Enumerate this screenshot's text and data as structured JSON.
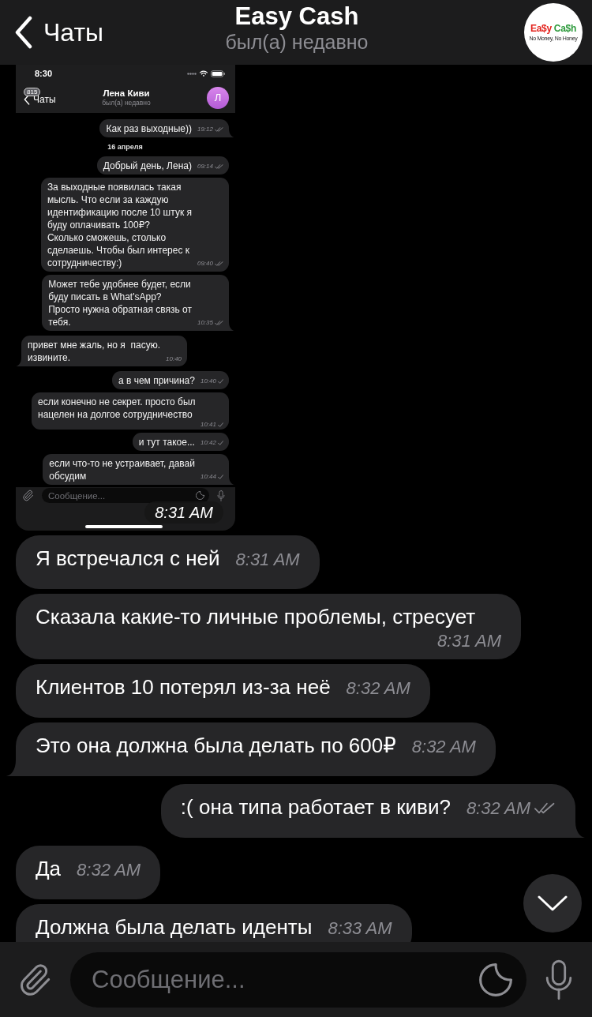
{
  "header": {
    "back_label": "Чаты",
    "title": "Easy Cash",
    "status": "был(а) недавно",
    "logo": {
      "words": [
        {
          "text": "Ea$y",
          "color": "#e3231d"
        },
        {
          "text": "Ca$h",
          "color": "#2d9a3b"
        }
      ],
      "slogan": "No Money, No Honey"
    }
  },
  "messages": [
    {
      "kind": "screenshot",
      "outgoing": false,
      "time": "8:31 AM",
      "screenshot": {
        "status_bar": {
          "time": "8:30"
        },
        "header": {
          "back_label": "Чаты",
          "unread_badge": "815",
          "title": "Лена Киви",
          "status": "был(а) недавно",
          "avatar_letter": "Л"
        },
        "messages": [
          {
            "kind": "text",
            "outgoing": true,
            "text": "Как раз выходные))",
            "time": "19:12",
            "read": true
          },
          {
            "kind": "date",
            "text": "16 апреля"
          },
          {
            "kind": "text",
            "outgoing": true,
            "text": "Добрый день, Лена)",
            "time": "09:14",
            "read": true
          },
          {
            "kind": "text",
            "outgoing": true,
            "text": "За выходные появилась такая\nмысль. Что если за каждую\nидентификацию после 10 штук я\nбуду оплачивать 100₽?\nСколько сможешь, столько\nсделаешь. Чтобы был интерес к\nсотрудничеству:)",
            "time": "09:40",
            "read": true
          },
          {
            "kind": "text",
            "outgoing": true,
            "text": "Может тебе удобнее будет, если\nбуду писать в What'sApp?\nПросто нужна обратная связь от\nтебя.",
            "time": "10:35",
            "read": true
          },
          {
            "kind": "text",
            "outgoing": false,
            "text": "привет мне жаль, но я  пасую.\nизвините.",
            "time": "10:40"
          },
          {
            "kind": "text",
            "outgoing": true,
            "text": "а в чем причина?",
            "time": "10:40",
            "read": false
          },
          {
            "kind": "text",
            "outgoing": true,
            "text": "если конечно не секрет. просто был\nнацелен на долгое сотрудничество",
            "time": "10:41",
            "read": false
          },
          {
            "kind": "text",
            "outgoing": true,
            "text": "и тут такое...",
            "time": "10:42",
            "read": false
          },
          {
            "kind": "text",
            "outgoing": true,
            "text": "если что-то не устраивает, давай\nобсудим",
            "time": "10:44",
            "read": false
          }
        ],
        "composer": {
          "placeholder": "Сообщение..."
        }
      }
    },
    {
      "kind": "text",
      "outgoing": false,
      "text": "Я встречался с ней",
      "time": "8:31 AM"
    },
    {
      "kind": "text",
      "outgoing": false,
      "text": "Сказала какие-то личные проблемы, стресует",
      "time": "8:31 AM"
    },
    {
      "kind": "text",
      "outgoing": false,
      "text": "Клиентов 10 потерял из-за неё",
      "time": "8:32 AM"
    },
    {
      "kind": "text",
      "outgoing": false,
      "text": "Это она должна была делать по 600₽",
      "time": "8:32 AM"
    },
    {
      "kind": "text",
      "outgoing": true,
      "text": ":( она типа работает в киви?",
      "time": "8:32 AM",
      "read": true
    },
    {
      "kind": "text",
      "outgoing": false,
      "text": "Да",
      "time": "8:32 AM"
    },
    {
      "kind": "text",
      "outgoing": false,
      "text": "Должна была делать иденты",
      "time": "8:33 AM"
    }
  ],
  "composer": {
    "placeholder": "Сообщение..."
  }
}
